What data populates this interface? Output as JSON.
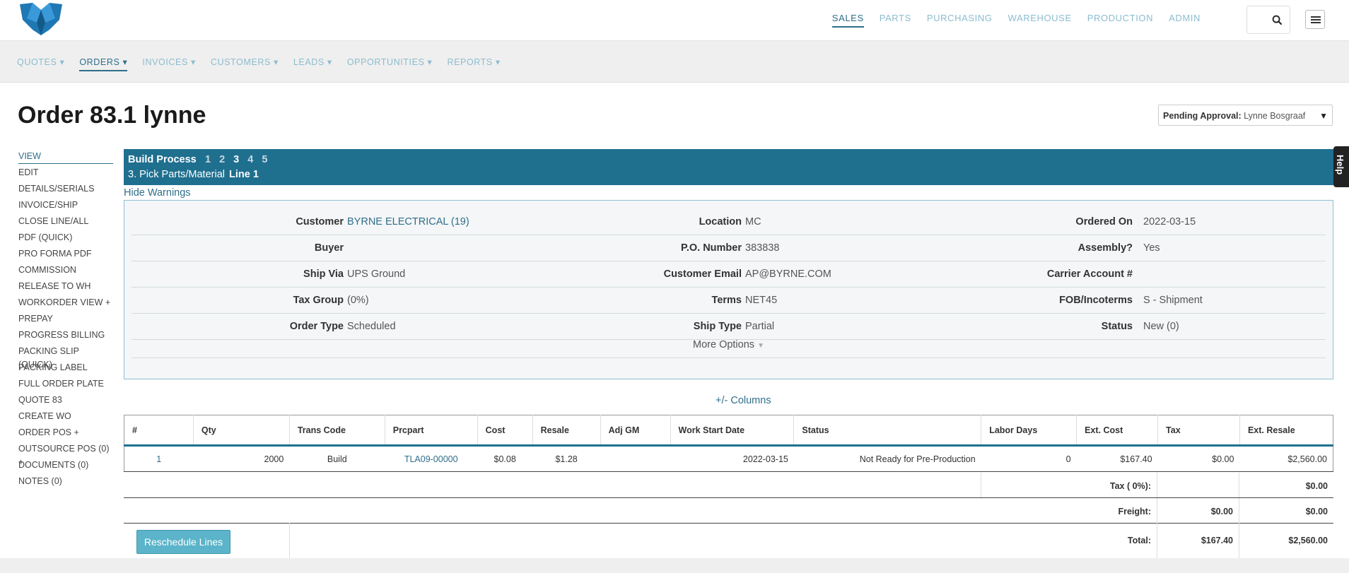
{
  "brand": {
    "logo": "company-logo"
  },
  "top_nav": [
    {
      "label": "SALES",
      "active": true
    },
    {
      "label": "PARTS"
    },
    {
      "label": "PURCHASING"
    },
    {
      "label": "WAREHOUSE"
    },
    {
      "label": "PRODUCTION"
    },
    {
      "label": "ADMIN"
    }
  ],
  "sub_nav": [
    {
      "label": "QUOTES ▾"
    },
    {
      "label": "ORDERS ▾",
      "active": true
    },
    {
      "label": "INVOICES ▾"
    },
    {
      "label": "CUSTOMERS ▾"
    },
    {
      "label": "LEADS ▾"
    },
    {
      "label": "OPPORTUNITIES ▾"
    },
    {
      "label": "REPORTS ▾"
    }
  ],
  "page": {
    "title": "Order 83.1 lynne",
    "approval_label": "Pending Approval:",
    "approval_value": "Lynne Bosgraaf",
    "help": "Help"
  },
  "sidebar": [
    "VIEW",
    "EDIT",
    "DETAILS/SERIALS",
    "INVOICE/SHIP",
    "CLOSE LINE/ALL",
    "PDF (QUICK)",
    "PRO FORMA PDF",
    "COMMISSION",
    "RELEASE TO WH",
    "WORKORDER VIEW +",
    "PREPAY",
    "PROGRESS BILLING",
    "PACKING SLIP (QUICK)",
    "PACKING LABEL",
    "FULL ORDER PLATE",
    "QUOTE 83",
    "CREATE WO",
    "ORDER POS +",
    "OUTSOURCE POS (0) +",
    "DOCUMENTS (0)",
    "NOTES (0)"
  ],
  "build": {
    "title": "Build Process",
    "steps": [
      "1",
      "2",
      "3",
      "4",
      "5"
    ],
    "current_step": "3",
    "current_label": "3. Pick Parts/Material",
    "line_label": "Line 1"
  },
  "hide_warnings": "Hide Warnings",
  "info_rows": [
    [
      {
        "label": "Customer",
        "value": "BYRNE ELECTRICAL (19)",
        "link": true
      },
      {
        "label": "Location",
        "value": "MC"
      },
      {
        "label": "Ordered On",
        "value": "2022-03-15"
      }
    ],
    [
      {
        "label": "Buyer",
        "value": ""
      },
      {
        "label": "P.O. Number",
        "value": "383838"
      },
      {
        "label": "Assembly?",
        "value": "Yes"
      }
    ],
    [
      {
        "label": "Ship Via",
        "value": "UPS Ground"
      },
      {
        "label": "Customer Email",
        "value": "AP@BYRNE.COM"
      },
      {
        "label": "Carrier Account #",
        "value": ""
      }
    ],
    [
      {
        "label": "Tax Group",
        "value": "(0%)"
      },
      {
        "label": "Terms",
        "value": "NET45"
      },
      {
        "label": "FOB/Incoterms",
        "value": "S - Shipment"
      }
    ],
    [
      {
        "label": "Order Type",
        "value": "Scheduled"
      },
      {
        "label": "Ship Type",
        "value": "Partial"
      },
      {
        "label": "Status",
        "value": "New (0)"
      }
    ]
  ],
  "more_options": "More Options",
  "columns_link": "+/- Columns",
  "table": {
    "headers": [
      "#",
      "Qty",
      "Trans Code",
      "Prcpart",
      "Cost",
      "Resale",
      "Adj GM",
      "Work Start Date",
      "Status",
      "Labor Days",
      "Ext. Cost",
      "Tax",
      "Ext. Resale"
    ],
    "rows": [
      [
        "1",
        "2000",
        "Build",
        "TLA09-00000",
        "$0.08",
        "$1.28",
        "",
        "2022-03-15",
        "Not Ready for Pre-Production",
        "0",
        "$167.40",
        "$0.00",
        "$2,560.00"
      ]
    ]
  },
  "totals": {
    "tax_label": "Tax ( 0%):",
    "tax_value": "$0.00",
    "freight_label": "Freight:",
    "freight_cost": "$0.00",
    "freight_resale": "$0.00",
    "total_label": "Total:",
    "total_cost": "$167.40",
    "total_resale": "$2,560.00"
  },
  "reschedule_button": "Reschedule Lines"
}
